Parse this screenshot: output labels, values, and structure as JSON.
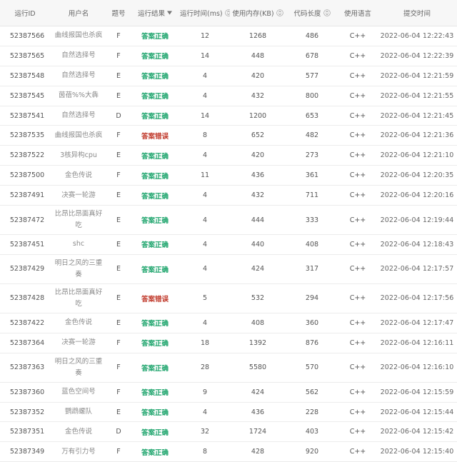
{
  "columns": {
    "run_id": "运行ID",
    "username": "用户名",
    "problem": "题号",
    "result": "运行结果",
    "time": "运行时间(ms)",
    "memory": "使用内存(KB)",
    "code_length": "代码长度",
    "language": "使用语言",
    "submit_time": "提交时间"
  },
  "icons": {
    "sort": "sort-icon",
    "filter": "filter-dropdown-icon"
  },
  "colors": {
    "accepted": "#1aa36a",
    "wrong_answer": "#c0392b",
    "header_bg": "#f7f7f7"
  },
  "rows": [
    {
      "id": "52387566",
      "user": "曲线报国也杀疯",
      "problem": "F",
      "result": "答案正确",
      "status": "ok",
      "time": "12",
      "memory": "1268",
      "length": "486",
      "lang": "C++",
      "submit": "2022-06-04 12:22:43"
    },
    {
      "id": "52387565",
      "user": "自然选择号",
      "problem": "F",
      "result": "答案正确",
      "status": "ok",
      "time": "14",
      "memory": "448",
      "length": "678",
      "lang": "C++",
      "submit": "2022-06-04 12:22:39"
    },
    {
      "id": "52387548",
      "user": "自然选择号",
      "problem": "E",
      "result": "答案正确",
      "status": "ok",
      "time": "4",
      "memory": "420",
      "length": "577",
      "lang": "C++",
      "submit": "2022-06-04 12:21:59"
    },
    {
      "id": "52387545",
      "user": "茵蓓%%大犇",
      "problem": "E",
      "result": "答案正确",
      "status": "ok",
      "time": "4",
      "memory": "432",
      "length": "800",
      "lang": "C++",
      "submit": "2022-06-04 12:21:55"
    },
    {
      "id": "52387541",
      "user": "自然选择号",
      "problem": "D",
      "result": "答案正确",
      "status": "ok",
      "time": "14",
      "memory": "1200",
      "length": "653",
      "lang": "C++",
      "submit": "2022-06-04 12:21:45"
    },
    {
      "id": "52387535",
      "user": "曲线报国也杀疯",
      "problem": "F",
      "result": "答案错误",
      "status": "wa",
      "time": "8",
      "memory": "652",
      "length": "482",
      "lang": "C++",
      "submit": "2022-06-04 12:21:36"
    },
    {
      "id": "52387522",
      "user": "3核异构cpu",
      "problem": "E",
      "result": "答案正确",
      "status": "ok",
      "time": "4",
      "memory": "420",
      "length": "273",
      "lang": "C++",
      "submit": "2022-06-04 12:21:10"
    },
    {
      "id": "52387500",
      "user": "金色传说",
      "problem": "F",
      "result": "答案正确",
      "status": "ok",
      "time": "11",
      "memory": "436",
      "length": "361",
      "lang": "C++",
      "submit": "2022-06-04 12:20:35"
    },
    {
      "id": "52387491",
      "user": "决赛一轮游",
      "problem": "E",
      "result": "答案正确",
      "status": "ok",
      "time": "4",
      "memory": "432",
      "length": "711",
      "lang": "C++",
      "submit": "2022-06-04 12:20:16"
    },
    {
      "id": "52387472",
      "user": "比昂比昂面真好吃",
      "problem": "E",
      "result": "答案正确",
      "status": "ok",
      "time": "4",
      "memory": "444",
      "length": "333",
      "lang": "C++",
      "submit": "2022-06-04 12:19:44"
    },
    {
      "id": "52387451",
      "user": "shc",
      "problem": "E",
      "result": "答案正确",
      "status": "ok",
      "time": "4",
      "memory": "440",
      "length": "408",
      "lang": "C++",
      "submit": "2022-06-04 12:18:43"
    },
    {
      "id": "52387429",
      "user": "明日之风的三重奏",
      "problem": "E",
      "result": "答案正确",
      "status": "ok",
      "time": "4",
      "memory": "424",
      "length": "317",
      "lang": "C++",
      "submit": "2022-06-04 12:17:57"
    },
    {
      "id": "52387428",
      "user": "比昂比昂面真好吃",
      "problem": "E",
      "result": "答案错误",
      "status": "wa",
      "time": "5",
      "memory": "532",
      "length": "294",
      "lang": "C++",
      "submit": "2022-06-04 12:17:56"
    },
    {
      "id": "52387422",
      "user": "金色传说",
      "problem": "E",
      "result": "答案正确",
      "status": "ok",
      "time": "4",
      "memory": "408",
      "length": "360",
      "lang": "C++",
      "submit": "2022-06-04 12:17:47"
    },
    {
      "id": "52387364",
      "user": "决赛一轮游",
      "problem": "F",
      "result": "答案正确",
      "status": "ok",
      "time": "18",
      "memory": "1392",
      "length": "876",
      "lang": "C++",
      "submit": "2022-06-04 12:16:11"
    },
    {
      "id": "52387363",
      "user": "明日之风的三重奏",
      "problem": "F",
      "result": "答案正确",
      "status": "ok",
      "time": "28",
      "memory": "5580",
      "length": "570",
      "lang": "C++",
      "submit": "2022-06-04 12:16:10"
    },
    {
      "id": "52387360",
      "user": "蓝色空间号",
      "problem": "F",
      "result": "答案正确",
      "status": "ok",
      "time": "9",
      "memory": "424",
      "length": "562",
      "lang": "C++",
      "submit": "2022-06-04 12:15:59"
    },
    {
      "id": "52387352",
      "user": "鹦鹉螺队",
      "problem": "E",
      "result": "答案正确",
      "status": "ok",
      "time": "4",
      "memory": "436",
      "length": "228",
      "lang": "C++",
      "submit": "2022-06-04 12:15:44"
    },
    {
      "id": "52387351",
      "user": "金色传说",
      "problem": "D",
      "result": "答案正确",
      "status": "ok",
      "time": "32",
      "memory": "1724",
      "length": "403",
      "lang": "C++",
      "submit": "2022-06-04 12:15:42"
    },
    {
      "id": "52387349",
      "user": "万有引力号",
      "problem": "F",
      "result": "答案正确",
      "status": "ok",
      "time": "8",
      "memory": "428",
      "length": "920",
      "lang": "C++",
      "submit": "2022-06-04 12:15:40"
    }
  ]
}
